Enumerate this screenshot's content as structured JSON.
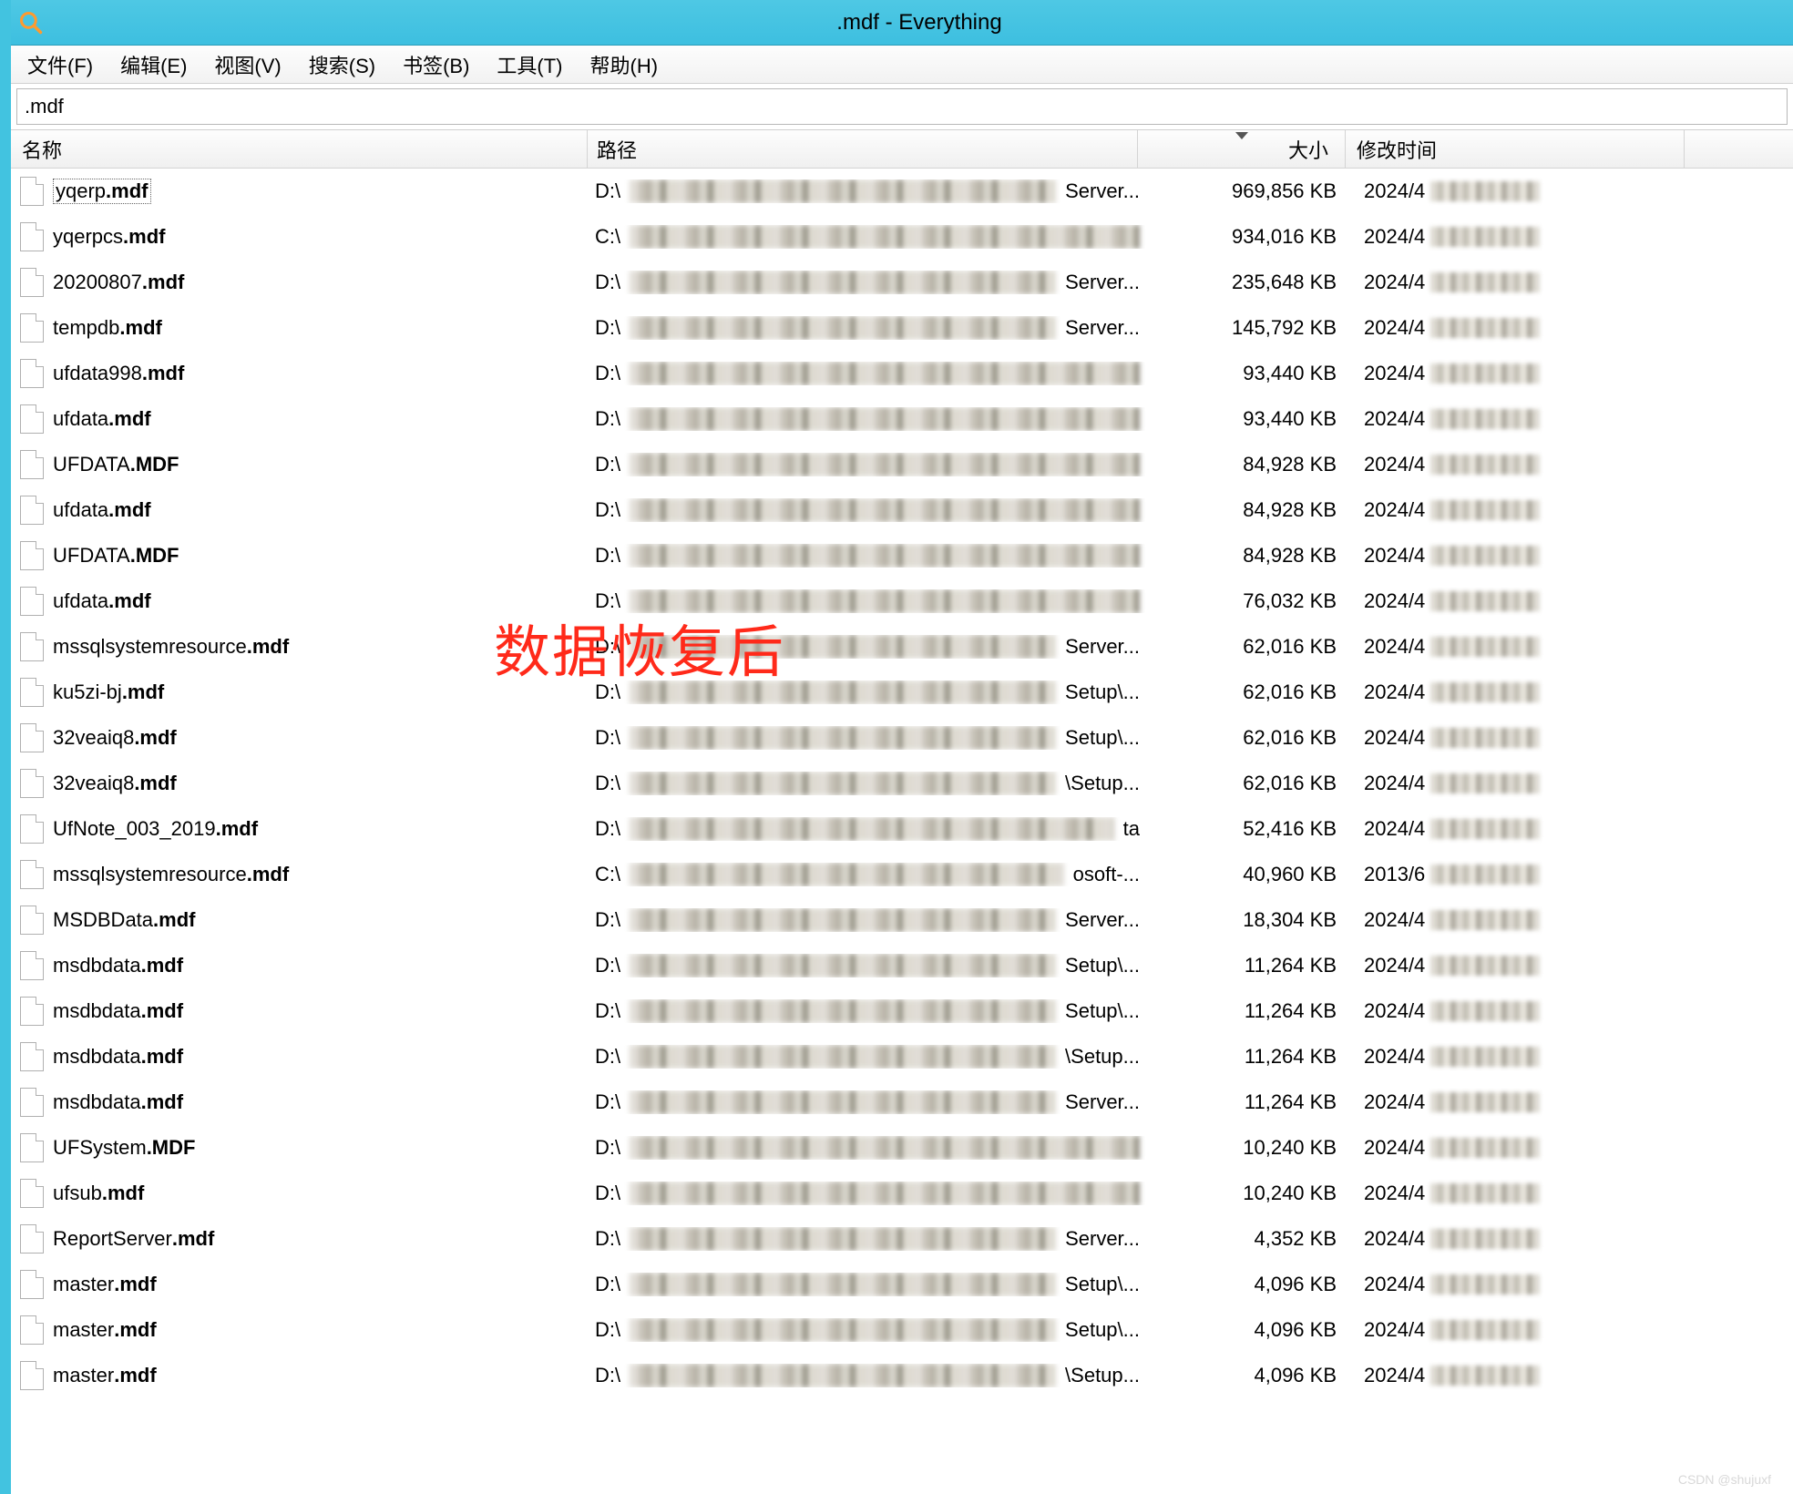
{
  "window": {
    "title": ".mdf - Everything"
  },
  "menu": {
    "file": "文件(F)",
    "edit": "编辑(E)",
    "view": "视图(V)",
    "search": "搜索(S)",
    "bookmark": "书签(B)",
    "tools": "工具(T)",
    "help": "帮助(H)"
  },
  "search_value": ".mdf",
  "headers": {
    "name": "名称",
    "path": "路径",
    "size": "大小",
    "date": "修改时间"
  },
  "overlay": "数据恢复后",
  "watermark": "CSDN @shujuxf",
  "rows": [
    {
      "name": "yqerp",
      "ext": ".mdf",
      "path_prefix": "D:\\",
      "path_suffix": "Server...",
      "size": "969,856 KB",
      "date": "2024/4"
    },
    {
      "name": "yqerpcs",
      "ext": ".mdf",
      "path_prefix": "C:\\",
      "path_suffix": "",
      "size": "934,016 KB",
      "date": "2024/4"
    },
    {
      "name": "20200807",
      "ext": ".mdf",
      "path_prefix": "D:\\",
      "path_suffix": "Server...",
      "size": "235,648 KB",
      "date": "2024/4"
    },
    {
      "name": "tempdb",
      "ext": ".mdf",
      "path_prefix": "D:\\",
      "path_suffix": "Server...",
      "size": "145,792 KB",
      "date": "2024/4"
    },
    {
      "name": "ufdata998",
      "ext": ".mdf",
      "path_prefix": "D:\\",
      "path_suffix": "",
      "size": "93,440 KB",
      "date": "2024/4"
    },
    {
      "name": "ufdata",
      "ext": ".mdf",
      "path_prefix": "D:\\",
      "path_suffix": "",
      "size": "93,440 KB",
      "date": "2024/4"
    },
    {
      "name": "UFDATA",
      "ext": ".MDF",
      "path_prefix": "D:\\",
      "path_suffix": "",
      "size": "84,928 KB",
      "date": "2024/4"
    },
    {
      "name": "ufdata",
      "ext": ".mdf",
      "path_prefix": "D:\\",
      "path_suffix": "",
      "size": "84,928 KB",
      "date": "2024/4"
    },
    {
      "name": "UFDATA",
      "ext": ".MDF",
      "path_prefix": "D:\\",
      "path_suffix": "",
      "size": "84,928 KB",
      "date": "2024/4"
    },
    {
      "name": "ufdata",
      "ext": ".mdf",
      "path_prefix": "D:\\",
      "path_suffix": "",
      "size": "76,032 KB",
      "date": "2024/4"
    },
    {
      "name": "mssqlsystemresource",
      "ext": ".mdf",
      "path_prefix": "D:\\",
      "path_suffix": "Server...",
      "size": "62,016 KB",
      "date": "2024/4"
    },
    {
      "name": "ku5zi-bj",
      "ext": ".mdf",
      "path_prefix": "D:\\",
      "path_suffix": "Setup\\...",
      "size": "62,016 KB",
      "date": "2024/4"
    },
    {
      "name": "32veaiq8",
      "ext": ".mdf",
      "path_prefix": "D:\\",
      "path_suffix": "Setup\\...",
      "size": "62,016 KB",
      "date": "2024/4"
    },
    {
      "name": "32veaiq8",
      "ext": ".mdf",
      "path_prefix": "D:\\",
      "path_suffix": "\\Setup...",
      "size": "62,016 KB",
      "date": "2024/4"
    },
    {
      "name": "UfNote_003_2019",
      "ext": ".mdf",
      "path_prefix": "D:\\",
      "path_suffix": "ta",
      "size": "52,416 KB",
      "date": "2024/4"
    },
    {
      "name": "mssqlsystemresource",
      "ext": ".mdf",
      "path_prefix": "C:\\",
      "path_suffix": "osoft-...",
      "size": "40,960 KB",
      "date": "2013/6"
    },
    {
      "name": "MSDBData",
      "ext": ".mdf",
      "path_prefix": "D:\\",
      "path_suffix": "Server...",
      "size": "18,304 KB",
      "date": "2024/4"
    },
    {
      "name": "msdbdata",
      "ext": ".mdf",
      "path_prefix": "D:\\",
      "path_suffix": "Setup\\...",
      "size": "11,264 KB",
      "date": "2024/4"
    },
    {
      "name": "msdbdata",
      "ext": ".mdf",
      "path_prefix": "D:\\",
      "path_suffix": "Setup\\...",
      "size": "11,264 KB",
      "date": "2024/4"
    },
    {
      "name": "msdbdata",
      "ext": ".mdf",
      "path_prefix": "D:\\",
      "path_suffix": "\\Setup...",
      "size": "11,264 KB",
      "date": "2024/4"
    },
    {
      "name": "msdbdata",
      "ext": ".mdf",
      "path_prefix": "D:\\",
      "path_suffix": "Server...",
      "size": "11,264 KB",
      "date": "2024/4"
    },
    {
      "name": "UFSystem",
      "ext": ".MDF",
      "path_prefix": "D:\\",
      "path_suffix": "",
      "size": "10,240 KB",
      "date": "2024/4"
    },
    {
      "name": "ufsub",
      "ext": ".mdf",
      "path_prefix": "D:\\",
      "path_suffix": "",
      "size": "10,240 KB",
      "date": "2024/4"
    },
    {
      "name": "ReportServer",
      "ext": ".mdf",
      "path_prefix": "D:\\",
      "path_suffix": "Server...",
      "size": "4,352 KB",
      "date": "2024/4"
    },
    {
      "name": "master",
      "ext": ".mdf",
      "path_prefix": "D:\\",
      "path_suffix": "Setup\\...",
      "size": "4,096 KB",
      "date": "2024/4"
    },
    {
      "name": "master",
      "ext": ".mdf",
      "path_prefix": "D:\\",
      "path_suffix": "Setup\\...",
      "size": "4,096 KB",
      "date": "2024/4"
    },
    {
      "name": "master",
      "ext": ".mdf",
      "path_prefix": "D:\\",
      "path_suffix": "\\Setup...",
      "size": "4,096 KB",
      "date": "2024/4"
    }
  ]
}
